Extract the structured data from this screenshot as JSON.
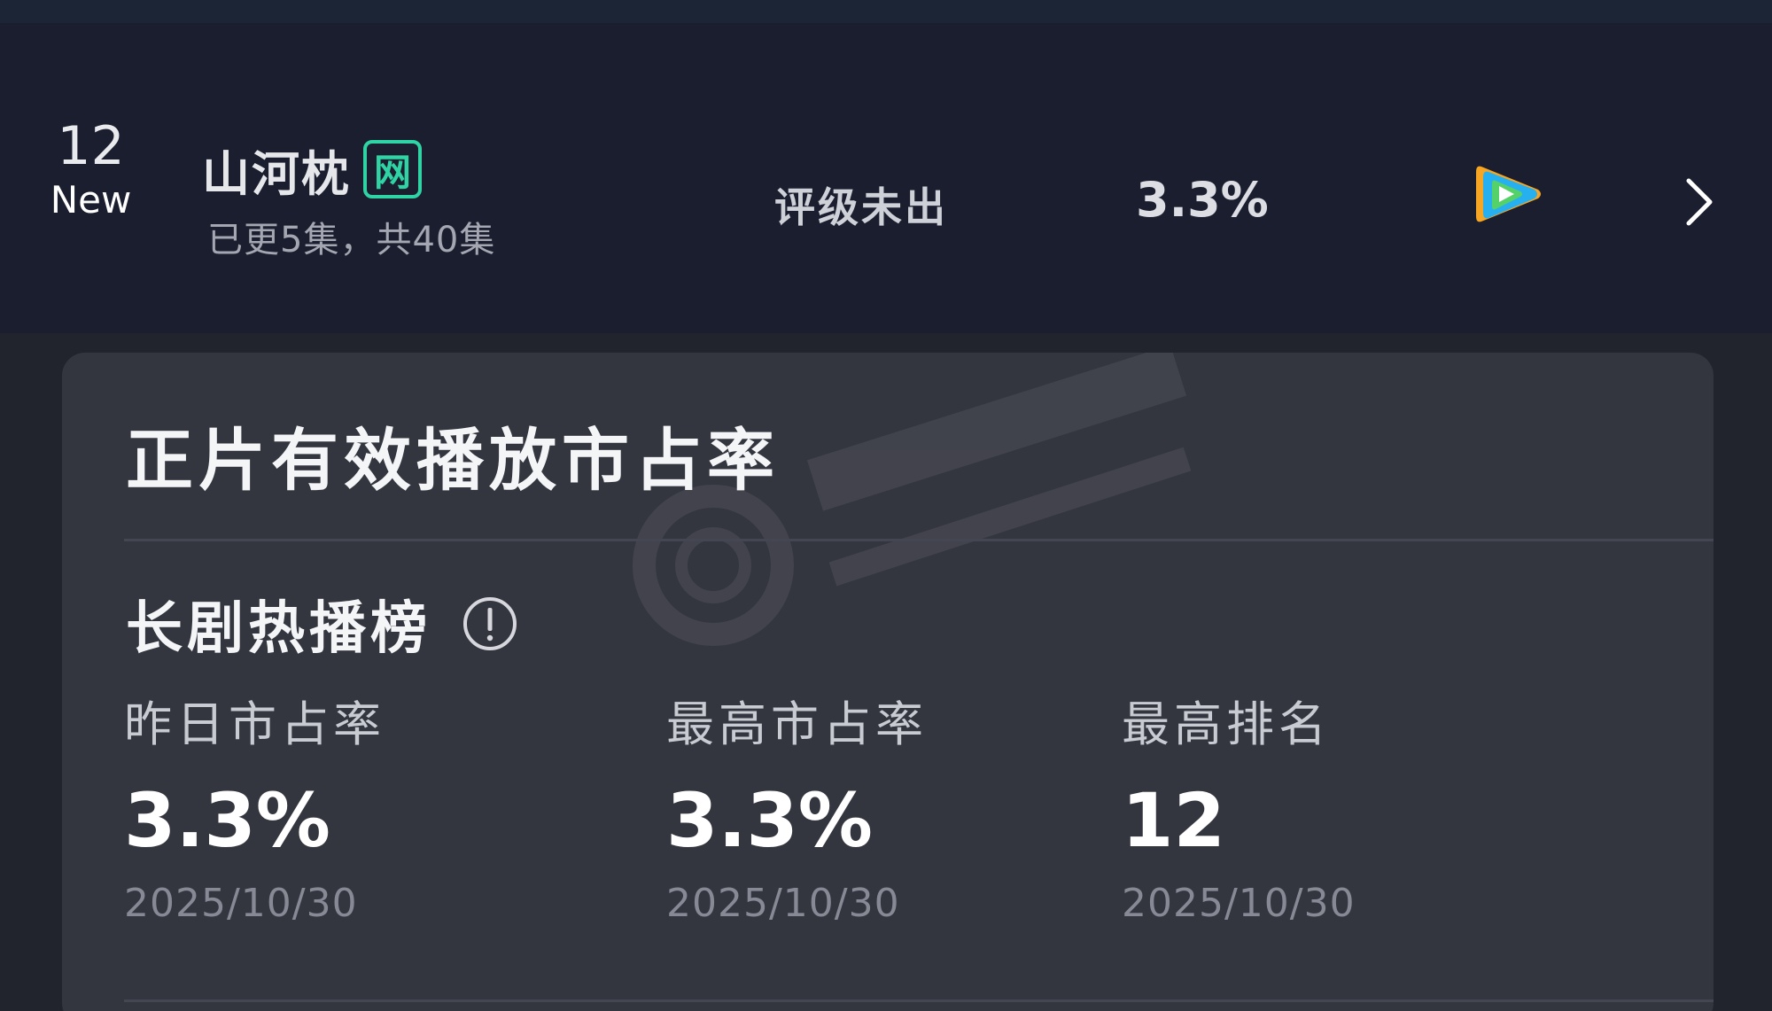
{
  "drama_row": {
    "rank": "12",
    "rank_tag": "New",
    "title": "山河枕",
    "badge": "网",
    "episodes": "已更5集，共40集",
    "rating_status": "评级未出",
    "market_share": "3.3%",
    "platform_icon": "tencent-video-play-icon",
    "chevron_icon": "chevron-right-icon"
  },
  "card": {
    "title": "正片有效播放市占率",
    "section_title": "长剧热播榜",
    "info_icon": "info-circle-icon",
    "watermark_icon": "enlightent-watermark-logo",
    "metrics": [
      {
        "label": "昨日市占率",
        "value": "3.3%",
        "date": "2025/10/30"
      },
      {
        "label": "最高市占率",
        "value": "3.3%",
        "date": "2025/10/30"
      },
      {
        "label": "最高排名",
        "value": "12",
        "date": "2025/10/30"
      }
    ]
  },
  "colors": {
    "background": "#22242d",
    "row_background": "#1a1e2e",
    "card_background": "#33353f",
    "badge_green": "#2fd3a4",
    "secondary_text": "#a4a7b2",
    "date_text": "#878a95"
  }
}
